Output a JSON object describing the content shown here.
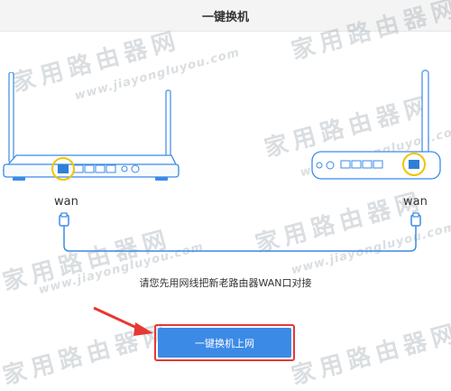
{
  "window": {
    "title": "一键换机"
  },
  "devices": {
    "left_port_label": "wan",
    "right_port_label": "wan"
  },
  "instruction": "请您先用网线把新老路由器WAN口对接",
  "action_button": {
    "label": "一键换机上网"
  },
  "watermark": {
    "cn": "家用路由器网",
    "en": "www.jiayongluyou.com"
  },
  "colors": {
    "button": "#3b8ae6",
    "highlight": "#e53935",
    "port_ring": "#f2c200",
    "wan_port": "#2f7fd8",
    "device_outline": "#3b8ae6"
  }
}
